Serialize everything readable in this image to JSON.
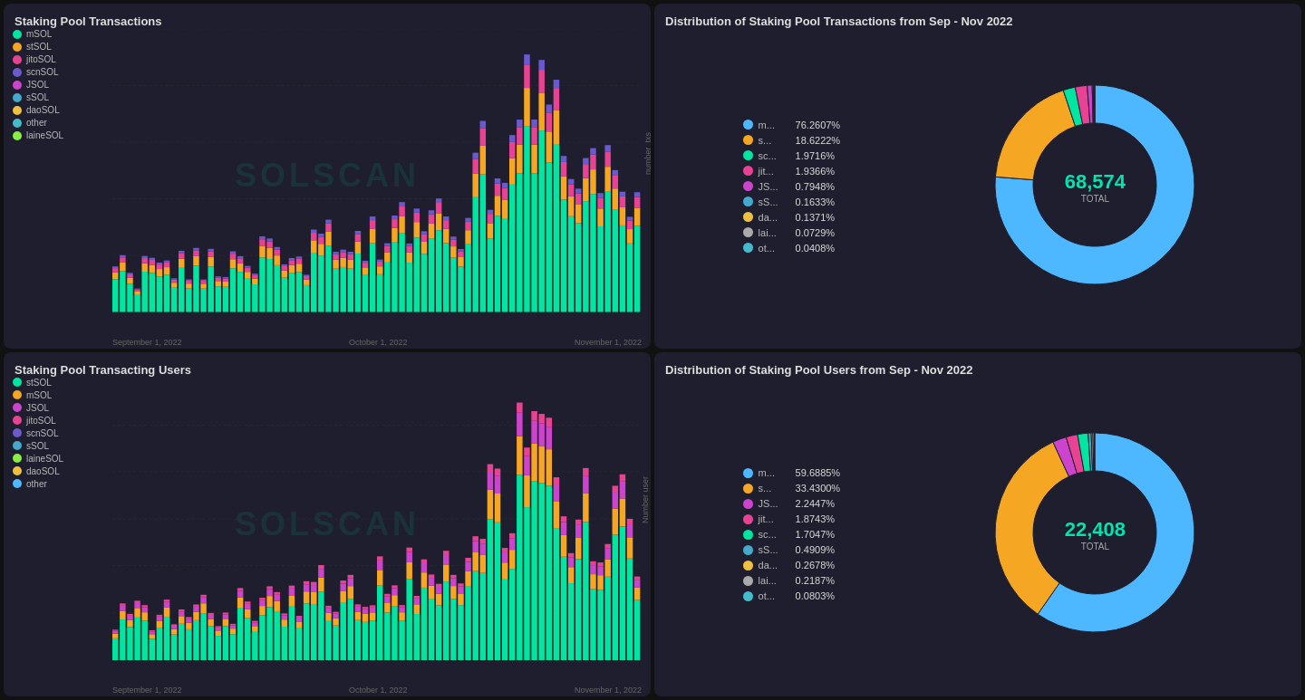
{
  "charts": {
    "topLeft": {
      "title": "Staking Pool Transactions",
      "yLabel": "number_txs",
      "xLabels": [
        "September 1, 2022",
        "October 1, 2022",
        "November 1, 2022"
      ],
      "watermark": "SOLSCAN",
      "legend": [
        {
          "label": "mSOL",
          "color": "#00e5a0"
        },
        {
          "label": "stSOL",
          "color": "#f5a623"
        },
        {
          "label": "jitoSOL",
          "color": "#e84393"
        },
        {
          "label": "scnSOL",
          "color": "#6a5acd"
        },
        {
          "label": "JSOL",
          "color": "#cc44cc"
        },
        {
          "label": "sSOL",
          "color": "#44aacc"
        },
        {
          "label": "daoSOL",
          "color": "#f0c040"
        },
        {
          "label": "other",
          "color": "#44bbcc"
        },
        {
          "label": "laineSOL",
          "color": "#88ee44"
        }
      ]
    },
    "topRight": {
      "title": "Distribution of Staking Pool Transactions from Sep - Nov 2022",
      "total": "68,574",
      "totalLabel": "TOTAL",
      "legend": [
        {
          "label": "m...",
          "pct": "76.2607%",
          "color": "#4db8ff"
        },
        {
          "label": "s...",
          "pct": "18.6222%",
          "color": "#f5a623"
        },
        {
          "label": "sc...",
          "pct": "1.9716%",
          "color": "#00e5a0"
        },
        {
          "label": "jit...",
          "pct": "1.9366%",
          "color": "#e84393"
        },
        {
          "label": "JS...",
          "pct": "0.7948%",
          "color": "#cc44cc"
        },
        {
          "label": "sS...",
          "pct": "0.1633%",
          "color": "#44aacc"
        },
        {
          "label": "da...",
          "pct": "0.1371%",
          "color": "#f0c040"
        },
        {
          "label": "lai...",
          "pct": "0.0729%",
          "color": "#aaaaaa"
        },
        {
          "label": "ot...",
          "pct": "0.0408%",
          "color": "#44bbcc"
        }
      ],
      "segments": [
        {
          "pct": 76.2607,
          "color": "#4db8ff"
        },
        {
          "pct": 18.6222,
          "color": "#f5a623"
        },
        {
          "pct": 1.9716,
          "color": "#00e5a0"
        },
        {
          "pct": 1.9366,
          "color": "#e84393"
        },
        {
          "pct": 0.7948,
          "color": "#cc44cc"
        },
        {
          "pct": 0.1633,
          "color": "#44aacc"
        },
        {
          "pct": 0.1371,
          "color": "#f0c040"
        },
        {
          "pct": 0.0729,
          "color": "#aaaaaa"
        },
        {
          "pct": 0.0408,
          "color": "#44bbcc"
        }
      ]
    },
    "bottomLeft": {
      "title": "Staking Pool Transacting Users",
      "yLabel": "Number user",
      "xLabels": [
        "September 1, 2022",
        "October 1, 2022",
        "November 1, 2022"
      ],
      "watermark": "SOLSCAN",
      "legend": [
        {
          "label": "stSOL",
          "color": "#00e5a0"
        },
        {
          "label": "mSOL",
          "color": "#f5a623"
        },
        {
          "label": "JSOL",
          "color": "#cc44cc"
        },
        {
          "label": "jitoSOL",
          "color": "#e84393"
        },
        {
          "label": "scnSOL",
          "color": "#6a5acd"
        },
        {
          "label": "sSOL",
          "color": "#44aacc"
        },
        {
          "label": "laineSOL",
          "color": "#88ee44"
        },
        {
          "label": "daoSOL",
          "color": "#f0c040"
        },
        {
          "label": "other",
          "color": "#4db8ff"
        }
      ]
    },
    "bottomRight": {
      "title": "Distribution of Staking Pool Users from Sep - Nov 2022",
      "total": "22,408",
      "totalLabel": "TOTAL",
      "legend": [
        {
          "label": "m...",
          "pct": "59.6885%",
          "color": "#4db8ff"
        },
        {
          "label": "s...",
          "pct": "33.4300%",
          "color": "#f5a623"
        },
        {
          "label": "JS...",
          "pct": "2.2447%",
          "color": "#cc44cc"
        },
        {
          "label": "jit...",
          "pct": "1.8743%",
          "color": "#e84393"
        },
        {
          "label": "sc...",
          "pct": "1.7047%",
          "color": "#00e5a0"
        },
        {
          "label": "sS...",
          "pct": "0.4909%",
          "color": "#44aacc"
        },
        {
          "label": "da...",
          "pct": "0.2678%",
          "color": "#f0c040"
        },
        {
          "label": "lai...",
          "pct": "0.2187%",
          "color": "#aaaaaa"
        },
        {
          "label": "ot...",
          "pct": "0.0803%",
          "color": "#44bbcc"
        }
      ],
      "segments": [
        {
          "pct": 59.6885,
          "color": "#4db8ff"
        },
        {
          "pct": 33.43,
          "color": "#f5a623"
        },
        {
          "pct": 2.2447,
          "color": "#cc44cc"
        },
        {
          "pct": 1.8743,
          "color": "#e84393"
        },
        {
          "pct": 1.7047,
          "color": "#00e5a0"
        },
        {
          "pct": 0.4909,
          "color": "#44aacc"
        },
        {
          "pct": 0.2678,
          "color": "#f0c040"
        },
        {
          "pct": 0.2187,
          "color": "#aaaaaa"
        },
        {
          "pct": 0.0803,
          "color": "#44bbcc"
        }
      ]
    }
  }
}
